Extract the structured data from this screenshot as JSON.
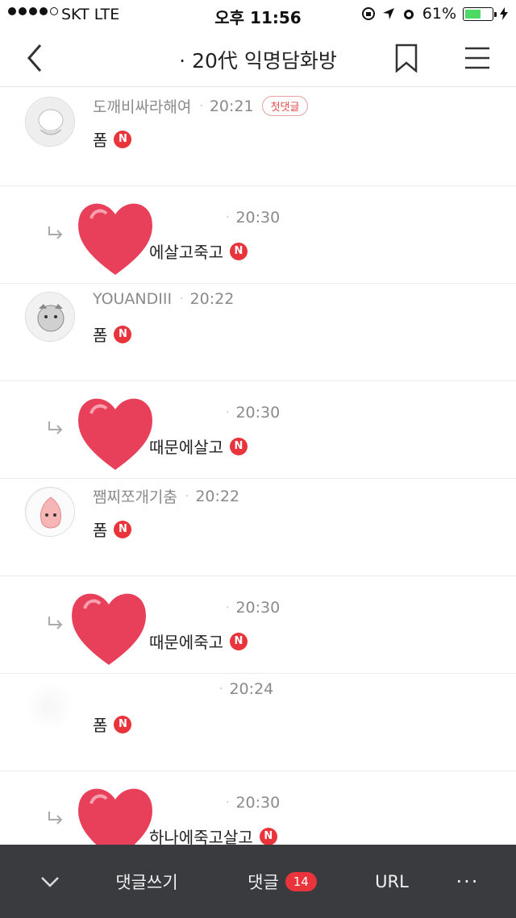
{
  "status_bar": {
    "carrier": "SKT   LTE",
    "time": "오후 11:56",
    "battery_text": "61%",
    "battery_level": 0.61
  },
  "header": {
    "title": "· 20代 익명담화방"
  },
  "comments": [
    {
      "author": "도깨비싸라해여",
      "time": "20:21",
      "badge": "첫댓글",
      "text": "폼",
      "new": "N"
    },
    {
      "author": "",
      "time": "20:30",
      "text": "에살고죽고",
      "new": "N"
    },
    {
      "author": "YOUANDIII",
      "time": "20:22",
      "text": "폼",
      "new": "N"
    },
    {
      "author": "",
      "time": "20:30",
      "text": "때문에살고",
      "new": "N"
    },
    {
      "author": "쨈찌쪼개기춤",
      "time": "20:22",
      "text": "폼",
      "new": "N"
    },
    {
      "author": "",
      "time": "20:30",
      "text": "때문에죽고",
      "new": "N"
    },
    {
      "author": "",
      "time": "20:24",
      "text": "폼",
      "new": "N"
    },
    {
      "author": "",
      "time": "20:30",
      "text": "하나에죽고살고",
      "new": "N"
    }
  ],
  "bottom_bar": {
    "write_label": "댓글쓰기",
    "comments_label": "댓글",
    "comments_count": "14",
    "url_label": "URL",
    "more_label": "···"
  },
  "colors": {
    "accent": "#e8343a",
    "bottom_bar": "#3a3b3e",
    "heart": "#e8405a"
  },
  "icons": [
    "back-icon",
    "bookmark-icon",
    "menu-icon",
    "chevron-down-icon",
    "reply-arrow-icon",
    "heart-sticker-icon"
  ]
}
